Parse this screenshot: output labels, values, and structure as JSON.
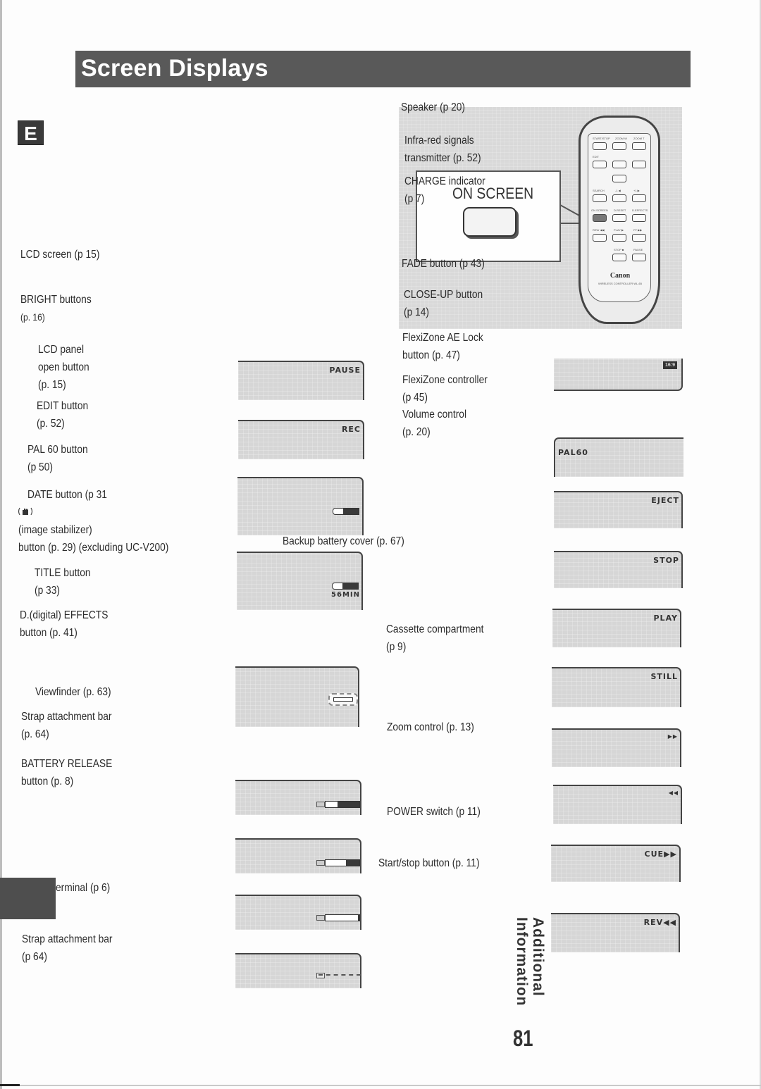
{
  "page": {
    "title": "Screen Displays",
    "language_tab": "E",
    "section": {
      "line1": "Additional",
      "line2": "Information"
    },
    "page_number": "81"
  },
  "left_labels": [
    {
      "text": "LCD screen (p  15)"
    },
    {
      "lines": [
        "BRIGHT buttons",
        "(p. 16)"
      ]
    },
    {
      "lines": [
        "LCD panel",
        "open button",
        "(p. 15)"
      ]
    },
    {
      "lines": [
        "EDIT button",
        "(p. 52)"
      ]
    },
    {
      "lines": [
        "PAL 60 button",
        "(p  50)"
      ]
    },
    {
      "text": "DATE button (p  31"
    },
    {
      "icon": "image-stabilizer-icon",
      "lines": [
        "(image stabilizer)",
        "button (p. 29) (excluding UC-V200)"
      ]
    },
    {
      "lines": [
        "TITLE button",
        "(p  33)"
      ]
    },
    {
      "lines": [
        "D.(digital) EFFECTS",
        " button (p. 41)"
      ]
    },
    {
      "text": "Viewfinder (p. 63)"
    },
    {
      "lines": [
        "Strap attachment bar",
        "(p. 64)"
      ]
    },
    {
      "lines": [
        "BATTERY RELEASE",
        "button (p. 8)"
      ]
    },
    {
      "text": "erminal (p  6)"
    },
    {
      "lines": [
        "Strap attachment bar",
        "(p  64)"
      ]
    }
  ],
  "remote_panel": {
    "labels": [
      {
        "text": "Speaker (p  20)"
      },
      {
        "lines": [
          "Infra-red signals",
          "transmitter (p. 52)"
        ]
      },
      {
        "lines": [
          "CHARGE indicator",
          "(p  7)"
        ]
      },
      {
        "text": "FADE button (p  43)"
      },
      {
        "lines": [
          "CLOSE-UP button",
          "(p  14)"
        ]
      }
    ],
    "callout_title": "ON SCREEN",
    "remote": {
      "brand": "Canon",
      "model": "WIRELESS CONTROLLER WL-65",
      "key_labels": [
        "START/STOP",
        "ZOOM W",
        "ZOOM T",
        "EDIT",
        "SEARCH",
        "-1 ◀",
        "+1 ▶",
        "ON SCREEN",
        "D.RESET",
        "D.EFFECTS",
        "REW ◀◀",
        "PLAY ▶",
        "FF ▶▶",
        "STOP ■",
        "PAUSE"
      ]
    }
  },
  "middle_labels": [
    {
      "lines": [
        "FlexiZone AE Lock",
        "button (p. 47)"
      ]
    },
    {
      "lines": [
        "FlexiZone controller",
        "(p  45)"
      ]
    },
    {
      "lines": [
        "Volume control",
        "(p. 20)"
      ]
    },
    {
      "text": "Backup battery cover (p. 67)"
    },
    {
      "lines": [
        "Cassette compartment",
        "(p  9)"
      ]
    },
    {
      "text": "Zoom control (p. 13)"
    },
    {
      "text": "POWER switch (p  11)"
    },
    {
      "text": "Start/stop button (p. 11)"
    }
  ],
  "lcd_left": [
    {
      "text": "PAUSE"
    },
    {
      "text": "REC"
    },
    {
      "battery_level": 0.6
    },
    {
      "battery_level": 0.6,
      "remaining": "56MIN"
    },
    {
      "cassette_warning": true
    },
    {
      "battery_level": 0.65
    },
    {
      "battery_level": 0.4
    },
    {
      "battery_level": 0.05
    },
    {
      "battery_level": 0
    }
  ],
  "lcd_right": [
    {
      "badge": "16:9"
    },
    {
      "text": "PAL60"
    },
    {
      "text": "EJECT"
    },
    {
      "text": "STOP"
    },
    {
      "text": "PLAY"
    },
    {
      "text": "STILL"
    },
    {
      "text": "▶▶"
    },
    {
      "text": "◀◀"
    },
    {
      "text": "CUE▶▶"
    },
    {
      "text": "REV◀◀"
    }
  ],
  "colors": {
    "title_bar": "#595959",
    "lcd_bg": "#d6d6d6",
    "panel_bg": "#d9d9d9",
    "ink": "#2b2b2b"
  }
}
